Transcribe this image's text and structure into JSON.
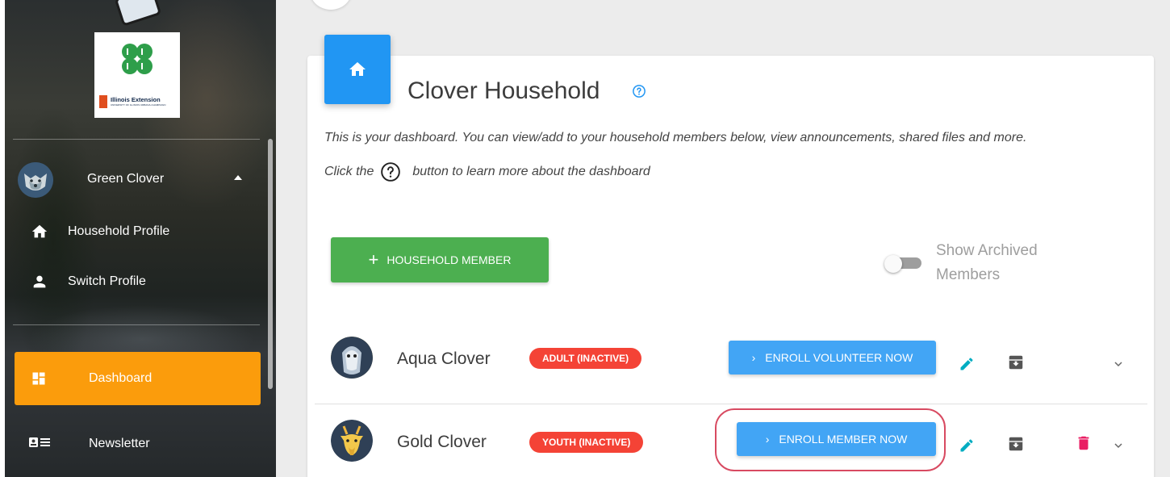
{
  "sidebar": {
    "logo": {
      "org_name": "Illinois Extension",
      "org_sub": "UNIVERSITY OF ILLINOIS URBANA-CHAMPAIGN"
    },
    "user": {
      "name": "Green Clover"
    },
    "profile_items": [
      {
        "label": "Household Profile",
        "icon": "home-icon"
      },
      {
        "label": "Switch Profile",
        "icon": "person-icon"
      }
    ],
    "nav_items": [
      {
        "label": "Dashboard",
        "icon": "dashboard-icon",
        "active": true
      },
      {
        "label": "Newsletter",
        "icon": "newsletter-icon",
        "active": false
      }
    ]
  },
  "main": {
    "title": "Clover Household",
    "intro": "This is your dashboard. You can view/add to your household members below, view announcements, shared files and more.",
    "click_prefix": "Click the",
    "click_suffix": "button to learn more about the dashboard",
    "add_button_label": "HOUSEHOLD MEMBER",
    "toggle_label": "Show Archived Members",
    "members": [
      {
        "name": "Aqua Clover",
        "badge": "ADULT (INACTIVE)",
        "action": "ENROLL VOLUNTEER NOW"
      },
      {
        "name": "Gold Clover",
        "badge": "YOUTH (INACTIVE)",
        "action": "ENROLL MEMBER NOW"
      }
    ]
  },
  "colors": {
    "primary_blue": "#2196f3",
    "enroll_blue": "#42a5f5",
    "success_green": "#4caf50",
    "active_orange": "#fb9c0c",
    "badge_red": "#f44336",
    "delete_pink": "#e91e63",
    "edit_teal": "#00acc1"
  }
}
